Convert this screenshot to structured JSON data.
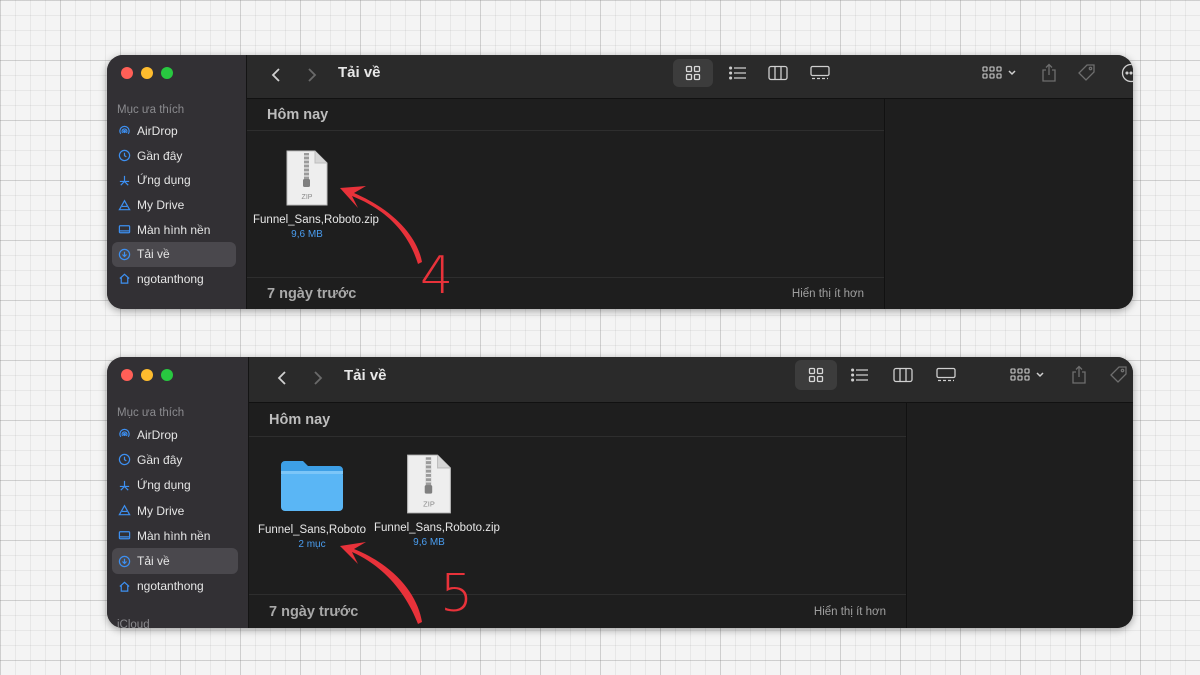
{
  "window1": {
    "sidebar": {
      "section": "Mục ưa thích",
      "items": [
        {
          "label": "AirDrop",
          "icon": "airdrop-icon"
        },
        {
          "label": "Gần đây",
          "icon": "clock-icon"
        },
        {
          "label": "Ứng dụng",
          "icon": "apps-icon"
        },
        {
          "label": "My Drive",
          "icon": "drive-icon"
        },
        {
          "label": "Màn hình nền",
          "icon": "desktop-icon"
        },
        {
          "label": "Tải về",
          "icon": "download-icon",
          "active": true
        },
        {
          "label": "ngotanthong",
          "icon": "home-icon"
        }
      ]
    },
    "toolbar": {
      "title": "Tải về"
    },
    "groups": {
      "today": "Hôm nay",
      "week": "7 ngày trước",
      "show_less": "Hiển thị ít hơn"
    },
    "files": [
      {
        "name": "Funnel_Sans,Roboto.zip",
        "meta": "9,6 MB",
        "type": "zip",
        "badge": "ZIP"
      }
    ],
    "step_label": "4"
  },
  "window2": {
    "sidebar": {
      "section": "Mục ưa thích",
      "items": [
        {
          "label": "AirDrop",
          "icon": "airdrop-icon"
        },
        {
          "label": "Gần đây",
          "icon": "clock-icon"
        },
        {
          "label": "Ứng dụng",
          "icon": "apps-icon"
        },
        {
          "label": "My Drive",
          "icon": "drive-icon"
        },
        {
          "label": "Màn hình nền",
          "icon": "desktop-icon"
        },
        {
          "label": "Tải về",
          "icon": "download-icon",
          "active": true
        },
        {
          "label": "ngotanthong",
          "icon": "home-icon"
        }
      ],
      "next_section": "iCloud"
    },
    "toolbar": {
      "title": "Tải về"
    },
    "groups": {
      "today": "Hôm nay",
      "week": "7 ngày trước",
      "show_less": "Hiển thị ít hơn"
    },
    "files": [
      {
        "name": "Funnel_Sans,Roboto",
        "meta": "2 mục",
        "type": "folder"
      },
      {
        "name": "Funnel_Sans,Roboto.zip",
        "meta": "9,6 MB",
        "type": "zip",
        "badge": "ZIP"
      }
    ],
    "step_label": "5"
  },
  "colors": {
    "accent": "#4a9df0",
    "folder": "#5ab6f5",
    "annotation": "#e8323a",
    "window_bg": "#1f1f1f",
    "sidebar_bg": "#323034"
  }
}
